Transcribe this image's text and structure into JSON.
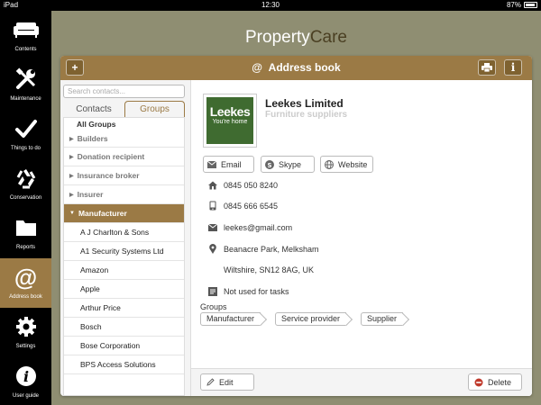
{
  "status": {
    "device": "iPad",
    "time": "12:30",
    "battery": "87%"
  },
  "brand": {
    "part1": "Property",
    "part2": "Care"
  },
  "nav": [
    {
      "label": "Contents",
      "icon": "sofa-icon"
    },
    {
      "label": "Maintenance",
      "icon": "tools-icon"
    },
    {
      "label": "Things to do",
      "icon": "checkmark-icon"
    },
    {
      "label": "Conservation",
      "icon": "recycle-icon"
    },
    {
      "label": "Reports",
      "icon": "folder-icon"
    },
    {
      "label": "Address book",
      "icon": "at-icon"
    },
    {
      "label": "Settings",
      "icon": "gear-icon"
    },
    {
      "label": "User guide",
      "icon": "info-icon"
    }
  ],
  "header": {
    "title": "Address book",
    "add_label": "+",
    "info_label": "i"
  },
  "search": {
    "placeholder": "Search contacts..."
  },
  "tabs": {
    "contacts": "Contacts",
    "groups": "Groups"
  },
  "list": {
    "all_groups": "All Groups",
    "groups": [
      "Builders",
      "Donation recipient",
      "Insurance broker",
      "Insurer",
      "Manufacturer"
    ],
    "items": [
      "A J Charlton & Sons",
      "A1 Security Systems Ltd",
      "Amazon",
      "Apple",
      "Arthur Price",
      "Bosch",
      "Bose Corporation",
      "BPS Access Solutions"
    ]
  },
  "contact": {
    "name": "Leekes Limited",
    "subtitle": "Furniture suppliers",
    "logo_line1": "Leekes",
    "logo_line2": "You're home",
    "actions": [
      "Email",
      "Skype",
      "Website"
    ],
    "phone1": "0845 050 8240",
    "phone2": "0845 666 6545",
    "email": "leekes@gmail.com",
    "address1": "Beanacre Park, Melksham",
    "address2": "Wiltshire, SN12 8AG, UK",
    "tasks_note": "Not used for tasks",
    "groups_label": "Groups",
    "groups": [
      "Manufacturer",
      "Service provider",
      "Supplier"
    ]
  },
  "footer": {
    "edit": "Edit",
    "delete": "Delete"
  },
  "colors": {
    "accent": "#9b7a45",
    "background": "#8f8e72",
    "sidebar": "#000000"
  }
}
